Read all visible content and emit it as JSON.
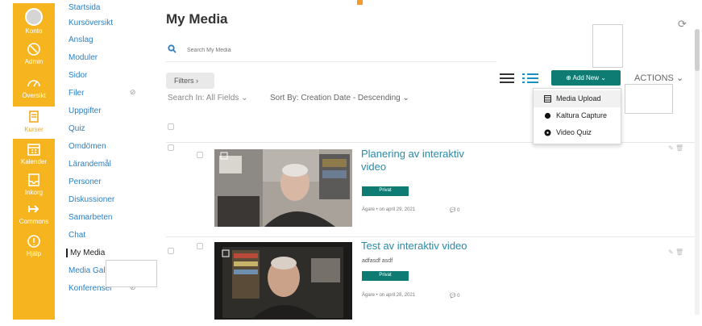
{
  "global_nav": [
    {
      "label": "Konto",
      "icon": "account-avatar-icon"
    },
    {
      "label": "Admin",
      "icon": "admin-shield-icon"
    },
    {
      "label": "Översikt",
      "icon": "dashboard-icon"
    },
    {
      "label": "Kurser",
      "icon": "courses-icon",
      "active": true
    },
    {
      "label": "Kalender",
      "icon": "calendar-icon"
    },
    {
      "label": "Inkorg",
      "icon": "inbox-icon"
    },
    {
      "label": "Commons",
      "icon": "commons-arrow-icon"
    },
    {
      "label": "Hjälp",
      "icon": "help-icon"
    }
  ],
  "course_nav": [
    {
      "label": "Startsida"
    },
    {
      "label": "Kursöversikt"
    },
    {
      "label": "Anslag"
    },
    {
      "label": "Moduler"
    },
    {
      "label": "Sidor"
    },
    {
      "label": "Filer",
      "hidden_icon": "eye-slash-icon"
    },
    {
      "label": "Uppgifter"
    },
    {
      "label": "Quiz"
    },
    {
      "label": "Omdömen"
    },
    {
      "label": "Lärandemål"
    },
    {
      "label": "Personer"
    },
    {
      "label": "Diskussioner"
    },
    {
      "label": "Samarbeten"
    },
    {
      "label": "Chat"
    },
    {
      "label": "My Media",
      "active": true
    },
    {
      "label": "Media Gallery"
    },
    {
      "label": "Konferenser",
      "hidden_icon": "eye-slash-icon"
    }
  ],
  "page": {
    "title": "My Media",
    "search_placeholder": "Search My Media",
    "filters_label": "Filters ›",
    "search_in": "Search In: All Fields ⌄",
    "sort_by": "Sort By: Creation Date - Descending ⌄",
    "add_new": "Add New ⌄",
    "actions": "ACTIONS ⌄"
  },
  "add_new_menu": [
    {
      "label": "Media Upload",
      "icon": "film-icon"
    },
    {
      "label": "Kaltura Capture",
      "icon": "record-dot-icon"
    },
    {
      "label": "Video Quiz",
      "icon": "quiz-icon"
    }
  ],
  "media_items": [
    {
      "title_line1": "Planering av interaktiv",
      "title_line2": "video",
      "description": "",
      "badge": "Privat",
      "owner": "Ägare  •  on april 29, 2021",
      "comments": "0"
    },
    {
      "title_line1": "Test av interaktiv video",
      "title_line2": "",
      "description": "adfasdf asdf",
      "badge": "Privat",
      "owner": "Ägare  •  on april 28, 2021",
      "comments": "0"
    }
  ],
  "colors": {
    "global_nav_bg": "#f6b51f",
    "link": "#2d7fbf",
    "accent": "#0f7c74",
    "title_link": "#2a8aa8"
  }
}
